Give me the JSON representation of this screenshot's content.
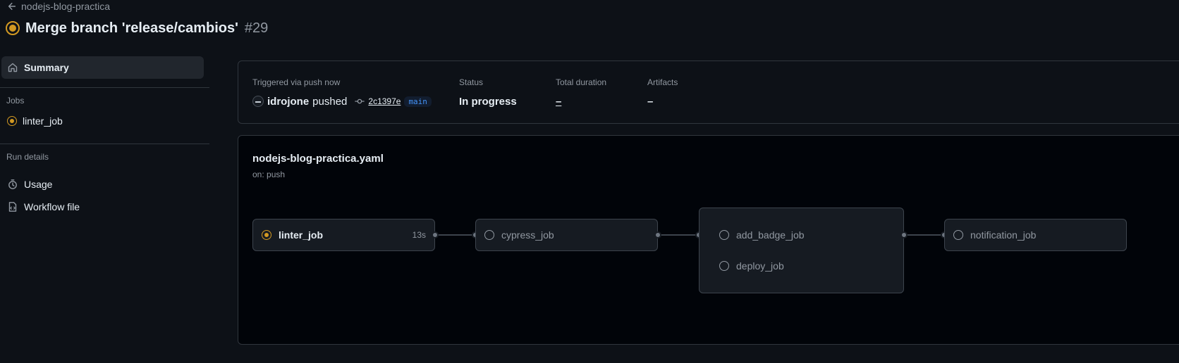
{
  "header": {
    "back_label": "nodejs-blog-practica",
    "run_title": "Merge branch 'release/cambios'",
    "run_number": "#29"
  },
  "sidebar": {
    "summary_label": "Summary",
    "jobs_heading": "Jobs",
    "jobs": [
      {
        "label": "linter_job",
        "status": "in_progress"
      }
    ],
    "run_details_heading": "Run details",
    "run_details": [
      {
        "label": "Usage",
        "icon": "stopwatch-icon"
      },
      {
        "label": "Workflow file",
        "icon": "file-icon"
      }
    ]
  },
  "summary": {
    "trigger_label": "Triggered via push now",
    "actor": "idrojone",
    "action": "pushed",
    "commit": "2c1397e",
    "branch": "main",
    "status_label": "Status",
    "status_value": "In progress",
    "duration_label": "Total duration",
    "duration_value": "–",
    "artifacts_label": "Artifacts",
    "artifacts_value": "–"
  },
  "workflow": {
    "file": "nodejs-blog-practica.yaml",
    "trigger": "on: push",
    "jobs": {
      "linter": {
        "name": "linter_job",
        "time": "13s",
        "status": "in_progress"
      },
      "cypress": {
        "name": "cypress_job",
        "status": "queued"
      },
      "add_badge": {
        "name": "add_badge_job",
        "status": "queued"
      },
      "deploy": {
        "name": "deploy_job",
        "status": "queued"
      },
      "notification": {
        "name": "notification_job",
        "status": "queued"
      }
    }
  },
  "colors": {
    "background": "#0d1117",
    "in_progress": "#d29922",
    "link": "#4493f8",
    "muted": "#9198a1"
  }
}
